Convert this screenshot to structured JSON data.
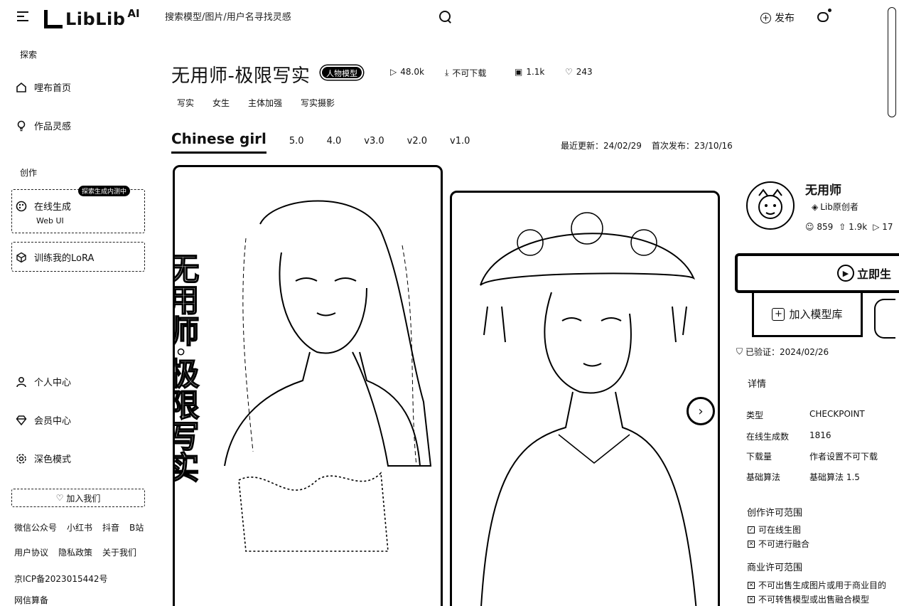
{
  "header": {
    "logo_text": "LibLib",
    "logo_sup": "AI",
    "search_placeholder": "搜索模型/图片/用户名寻找灵感",
    "publish_label": "发布"
  },
  "sidebar": {
    "section_explore": "探索",
    "home": "哩布首页",
    "inspiration": "作品灵感",
    "section_create": "创作",
    "online_gen": "在线生成",
    "online_gen_sub": "Web UI",
    "beta_badge": "探索生成内测中",
    "train_lora": "训练我的LoRA",
    "personal": "个人中心",
    "member": "会员中心",
    "dark_mode": "深色模式",
    "join_us": "加入我们",
    "links_row1": [
      "微信公众号",
      "小红书",
      "抖音",
      "B站"
    ],
    "links_row2": [
      "用户协议",
      "隐私政策",
      "关于我们"
    ],
    "icp": "京ICP备2023015442号",
    "algo_filing": "网信算备"
  },
  "model": {
    "title": "无用师-极限写实",
    "badge": "人物模型",
    "stats": {
      "runs": "48.0k",
      "download": "不可下载",
      "images": "1.1k",
      "likes": "243"
    },
    "tags": [
      "写实",
      "女生",
      "主体加强",
      "写实摄影"
    ],
    "active_version": "Chinese girl",
    "versions": [
      "5.0",
      "4.0",
      "v3.0",
      "v2.0",
      "v1.0"
    ],
    "last_updated": "最近更新：24/02/29",
    "first_published": "首次发布：23/10/16"
  },
  "author": {
    "name": "无用师",
    "badge": "Lib原创者",
    "followers": "859",
    "likes": "1.9k",
    "models": "17"
  },
  "actions": {
    "run_label": "立即生",
    "add_library": "加入模型库",
    "verified": "已验证：2024/02/26"
  },
  "details": {
    "heading": "详情",
    "rows": [
      {
        "k": "类型",
        "v": "CHECKPOINT"
      },
      {
        "k": "在线生成数",
        "v": "1816"
      },
      {
        "k": "下载量",
        "v": "作者设置不可下载"
      },
      {
        "k": "基础算法",
        "v": "基础算法 1.5"
      }
    ],
    "create_license_title": "创作许可范围",
    "create_license": [
      "可在线生图",
      "不可进行融合"
    ],
    "commercial_title": "商业许可范围",
    "commercial": [
      "不可出售生成图片或用于商业目的",
      "不可转售模型或出售融合模型"
    ]
  },
  "images": {
    "poster_text": "无用师·极限写实"
  }
}
